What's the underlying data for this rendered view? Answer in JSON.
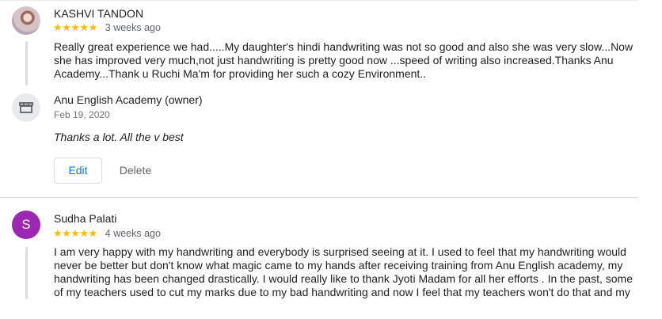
{
  "reviews": [
    {
      "name": "KASHVI TANDON",
      "stars": "★★★★★",
      "date": "3 weeks ago",
      "text": "Really great experience we had.....My daughter's hindi handwriting was not so good and also she was very slow...Now she has improved very much,not just handwriting is pretty good now ...speed of writing also increased.Thanks Anu Academy...Thank u Ruchi Ma'm for providing her such a cozy Environment..",
      "owner_reply": {
        "name": "Anu English Academy (owner)",
        "date": "Feb 19, 2020",
        "text": "Thanks a lot. All the v best",
        "edit_label": "Edit",
        "delete_label": "Delete"
      }
    },
    {
      "avatar_letter": "S",
      "avatar_color": "#9c27b0",
      "name": "Sudha Palati",
      "stars": "★★★★★",
      "date": "4 weeks ago",
      "text": "I am very happy with my handwriting and everybody is surprised seeing at it. I used to feel that my handwriting would never be better but don't know what magic came to my hands after receiving training from Anu English academy, my handwriting has been changed drastically. I would really like to thank Jyoti Madam for all her efforts . In the past, some of my teachers used to cut my marks due to my bad handwriting and now I feel that my teachers won't do that and my"
    }
  ],
  "colors": {
    "star": "#fbbc04",
    "link": "#1a73e8",
    "divider": "#dadce0"
  }
}
